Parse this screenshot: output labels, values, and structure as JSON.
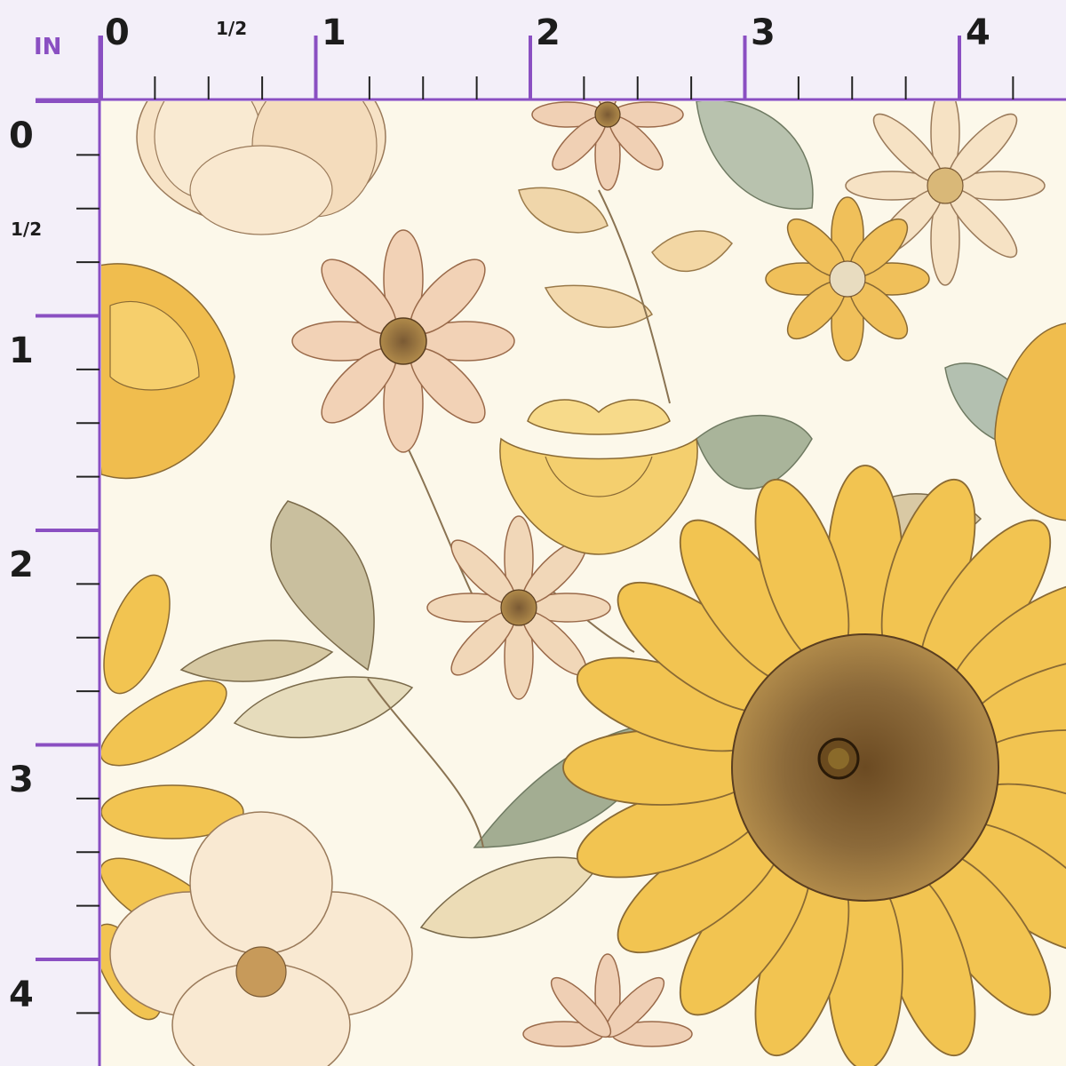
{
  "ruler": {
    "unit": "IN",
    "top_labels": [
      "0",
      "1/2",
      "1",
      "2",
      "3",
      "4"
    ],
    "left_labels": [
      "0",
      "1/2",
      "1",
      "2",
      "3",
      "4"
    ]
  },
  "colors": {
    "ruler_background": "#f3eff9",
    "ruler_accent": "#8a4fc2",
    "ruler_tick": "#222222",
    "fabric_background": "#fcf8ea",
    "sunflower_petal": "#f2c451",
    "sunflower_center": "#8c6a3a",
    "blush_petal": "#f2d2b6",
    "cream_petal": "#f7e3c6",
    "leaf_sage": "#a9b49a",
    "leaf_tan": "#d7c7a0"
  },
  "fabric": {
    "pattern": "floral",
    "motifs": [
      "sunflower-icon",
      "daisy-icon",
      "rose-icon",
      "peony-icon",
      "leaf-icon"
    ]
  }
}
